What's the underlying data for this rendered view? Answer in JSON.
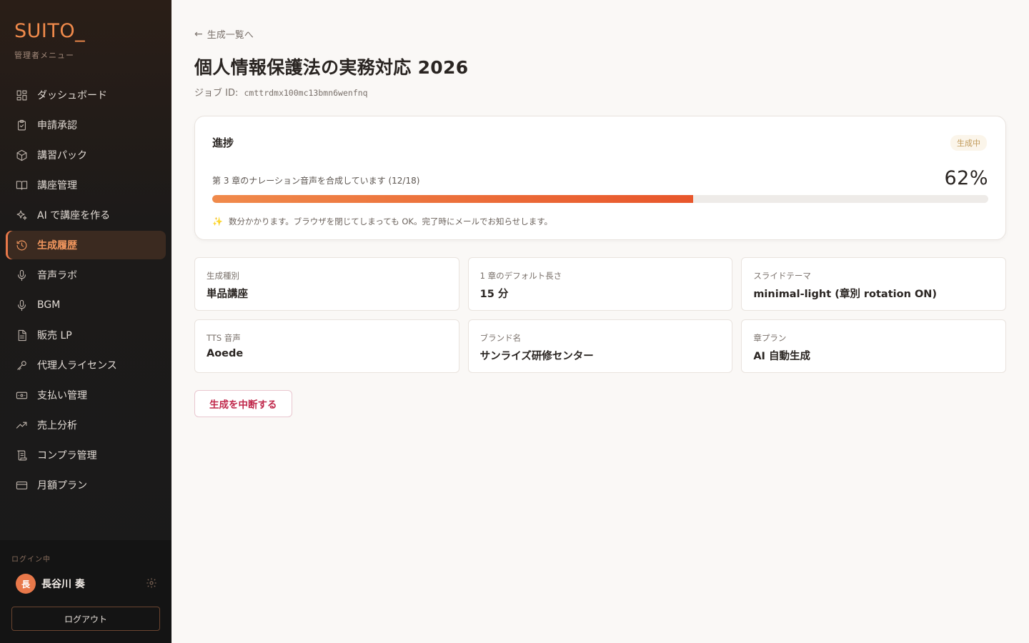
{
  "sidebar": {
    "brand": "SUITO_",
    "subtitle": "管理者メニュー",
    "items": [
      {
        "label": "ダッシュボード",
        "icon": "dashboard-icon"
      },
      {
        "label": "申請承認",
        "icon": "clipboard-check-icon"
      },
      {
        "label": "講習パック",
        "icon": "package-icon"
      },
      {
        "label": "講座管理",
        "icon": "book-open-icon"
      },
      {
        "label": "AI で講座を作る",
        "icon": "sparkles-icon"
      },
      {
        "label": "生成履歴",
        "icon": "history-icon",
        "active": true
      },
      {
        "label": "音声ラボ",
        "icon": "microphone-icon"
      },
      {
        "label": "BGM",
        "icon": "microphone-icon"
      },
      {
        "label": "販売 LP",
        "icon": "file-text-icon"
      },
      {
        "label": "代理人ライセンス",
        "icon": "key-icon"
      },
      {
        "label": "支払い管理",
        "icon": "banknote-icon"
      },
      {
        "label": "売上分析",
        "icon": "trending-up-icon"
      },
      {
        "label": "コンプラ管理",
        "icon": "scroll-icon"
      },
      {
        "label": "月額プラン",
        "icon": "credit-card-icon"
      }
    ],
    "login_label": "ログイン中",
    "user": {
      "avatar": "長",
      "name": "長谷川 奏"
    },
    "logout_label": "ログアウト"
  },
  "main": {
    "back_label": "生成一覧へ",
    "title": "個人情報保護法の実務対応 2026",
    "job_id_label": "ジョブ ID:",
    "job_id": "cmttrdmx100mc13bmn6wenfnq",
    "progress": {
      "title": "進捗",
      "status": "生成中",
      "message": "第 3 章のナレーション音声を合成しています (12/18)",
      "percent_label": "62%",
      "percent": 62,
      "note": "数分かかります。ブラウザを閉じてしまっても OK。完了時にメールでお知らせします。"
    },
    "details": [
      {
        "label": "生成種別",
        "value": "単品講座"
      },
      {
        "label": "1 章のデフォルト長さ",
        "value": "15 分"
      },
      {
        "label": "スライドテーマ",
        "value": "minimal-light (章別 rotation ON)"
      },
      {
        "label": "TTS 音声",
        "value": "Aoede"
      },
      {
        "label": "ブランド名",
        "value": "サンライズ研修センター"
      },
      {
        "label": "章プラン",
        "value": "AI 自動生成"
      }
    ],
    "stop_label": "生成を中断する"
  },
  "colors": {
    "accent": "#e8784a",
    "danger": "#c0284b",
    "sidebar_bg": "#1a1a1a"
  }
}
